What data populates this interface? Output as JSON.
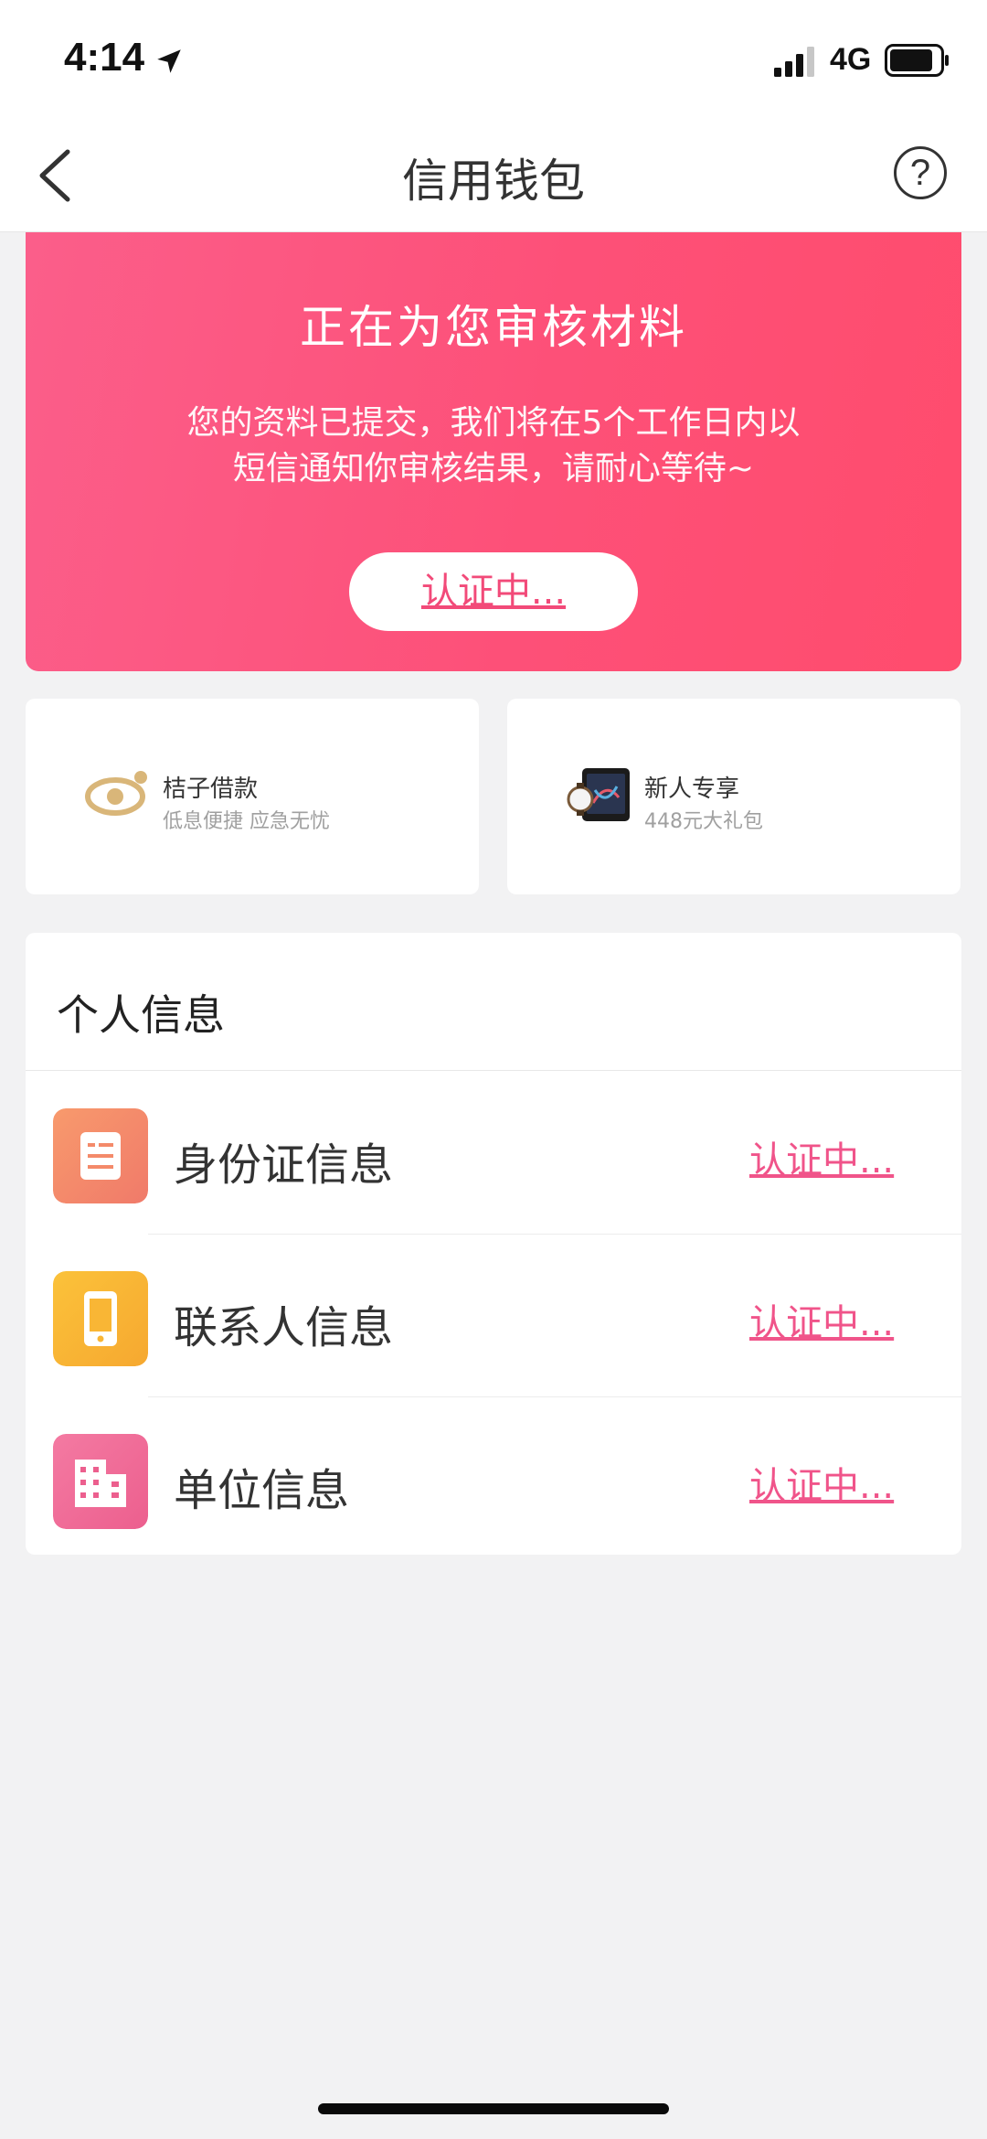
{
  "status_bar": {
    "time": "4:14",
    "network": "4G",
    "icons": [
      "location-arrow-icon",
      "signal-icon",
      "battery-icon"
    ]
  },
  "nav": {
    "title": "信用钱包",
    "back_icon": "chevron-left-icon",
    "help_label": "?"
  },
  "banner": {
    "title": "正在为您审核材料",
    "desc_line1": "您的资料已提交，我们将在5个工作日内以",
    "desc_line2": "短信通知你审核结果，请耐心等待~",
    "button_label": "认证中...",
    "gradient": [
      "#fb5e8a",
      "#ff4c6d"
    ]
  },
  "promos": [
    {
      "title": "桔子借款",
      "subtitle": "低息便捷  应急无忧",
      "icon": "coin-eye-icon"
    },
    {
      "title": "新人专享",
      "subtitle": "448元大礼包",
      "icon": "phone-watch-gift-icon"
    }
  ],
  "personal_info": {
    "section_title": "个人信息",
    "items": [
      {
        "label": "身份证信息",
        "status": "认证中...",
        "icon": "id-card-icon",
        "color": "#f48a6a"
      },
      {
        "label": "联系人信息",
        "status": "认证中...",
        "icon": "phone-icon",
        "color": "#f9b635"
      },
      {
        "label": "单位信息",
        "status": "认证中...",
        "icon": "building-icon",
        "color": "#f06e9a"
      }
    ]
  },
  "colors": {
    "accent": "#f0548a",
    "background": "#f2f2f3"
  }
}
